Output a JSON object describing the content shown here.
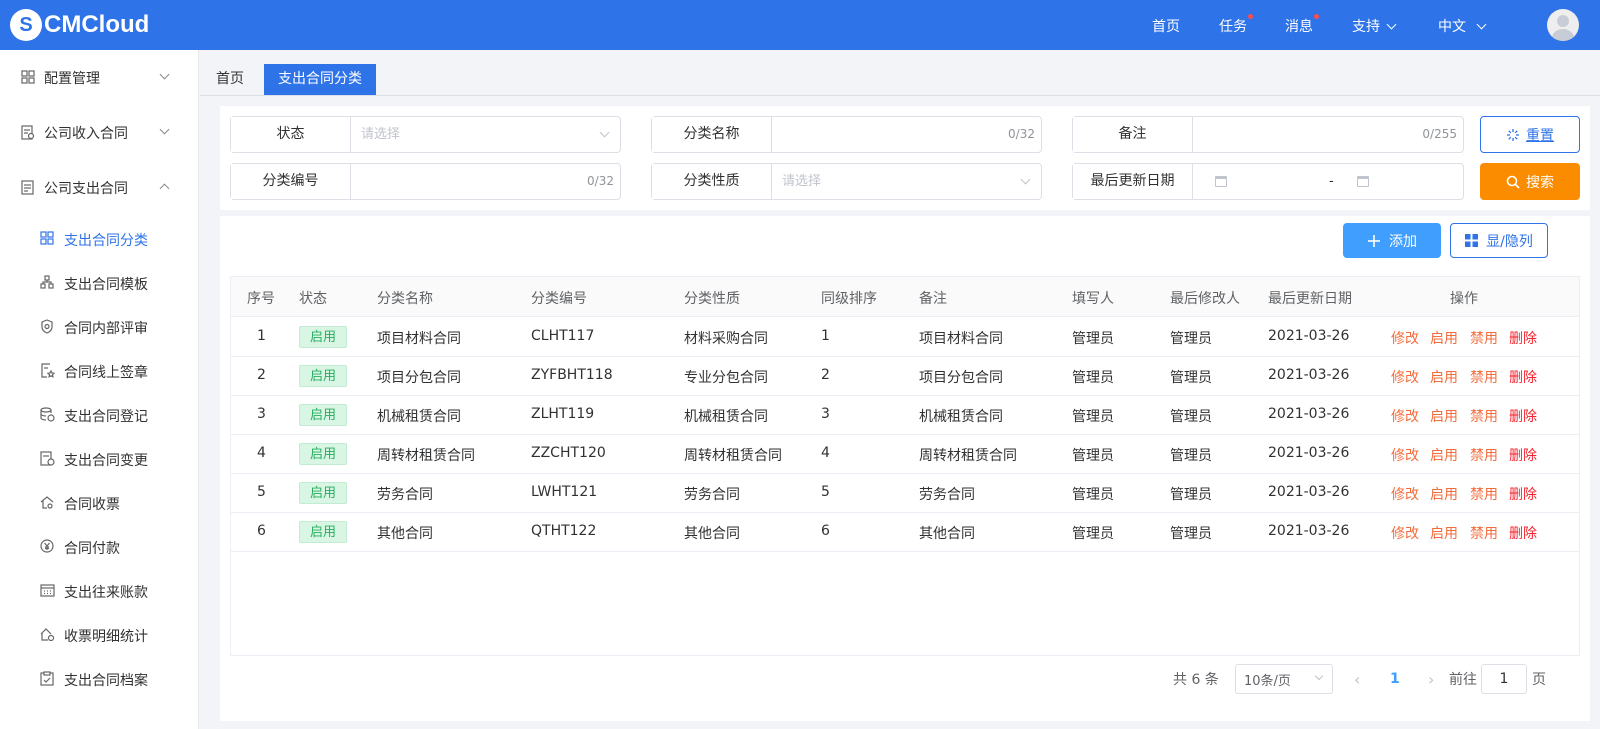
{
  "app": {
    "logo_text": "CMCloud",
    "logo_mark": "S"
  },
  "topnav": {
    "home": "首页",
    "tasks": "任务",
    "messages": "消息",
    "support": "支持",
    "language": "中文"
  },
  "sidebar": {
    "groups": [
      {
        "label": "配置管理",
        "icon": "grid-icon"
      },
      {
        "label": "公司收入合同",
        "icon": "contract-icon"
      },
      {
        "label": "公司支出合同",
        "icon": "document-icon"
      }
    ],
    "items": [
      {
        "label": "支出合同分类",
        "icon": "grid-icon"
      },
      {
        "label": "支出合同模板",
        "icon": "org-chart-icon"
      },
      {
        "label": "合同内部评审",
        "icon": "shield-icon"
      },
      {
        "label": "合同线上签章",
        "icon": "star-document-icon"
      },
      {
        "label": "支出合同登记",
        "icon": "database-icon"
      },
      {
        "label": "支出合同变更",
        "icon": "swap-document-icon"
      },
      {
        "label": "合同收票",
        "icon": "home-icon"
      },
      {
        "label": "合同付款",
        "icon": "yen-icon"
      },
      {
        "label": "支出往来账款",
        "icon": "calendar-icon"
      },
      {
        "label": "收票明细统计",
        "icon": "building-icon"
      },
      {
        "label": "支出合同档案",
        "icon": "clipboard-icon"
      }
    ]
  },
  "tabs": [
    {
      "label": "首页"
    },
    {
      "label": "支出合同分类"
    }
  ],
  "filters": {
    "status_label": "状态",
    "status_placeholder": "请选择",
    "name_label": "分类名称",
    "name_count": "0/32",
    "remark_label": "备注",
    "remark_count": "0/255",
    "code_label": "分类编号",
    "code_count": "0/32",
    "nature_label": "分类性质",
    "nature_placeholder": "请选择",
    "date_label": "最后更新日期",
    "date_sep": "-",
    "reset": "重置",
    "search": "搜索"
  },
  "toolbar": {
    "add": "添加",
    "columns": "显/隐列"
  },
  "table": {
    "headers": [
      "序号",
      "状态",
      "分类名称",
      "分类编号",
      "分类性质",
      "同级排序",
      "备注",
      "填写人",
      "最后修改人",
      "最后更新日期",
      "操作"
    ],
    "actions": [
      "修改",
      "启用",
      "禁用",
      "删除"
    ],
    "rows": [
      {
        "no": "1",
        "status": "启用",
        "name": "项目材料合同",
        "code": "CLHT117",
        "nature": "材料采购合同",
        "order": "1",
        "remark": "项目材料合同",
        "creator": "管理员",
        "modifier": "管理员",
        "date": "2021-03-26"
      },
      {
        "no": "2",
        "status": "启用",
        "name": "项目分包合同",
        "code": "ZYFBHT118",
        "nature": "专业分包合同",
        "order": "2",
        "remark": "项目分包合同",
        "creator": "管理员",
        "modifier": "管理员",
        "date": "2021-03-26"
      },
      {
        "no": "3",
        "status": "启用",
        "name": "机械租赁合同",
        "code": "ZLHT119",
        "nature": "机械租赁合同",
        "order": "3",
        "remark": "机械租赁合同",
        "creator": "管理员",
        "modifier": "管理员",
        "date": "2021-03-26"
      },
      {
        "no": "4",
        "status": "启用",
        "name": "周转材租赁合同",
        "code": "ZZCHT120",
        "nature": "周转材租赁合同",
        "order": "4",
        "remark": "周转材租赁合同",
        "creator": "管理员",
        "modifier": "管理员",
        "date": "2021-03-26"
      },
      {
        "no": "5",
        "status": "启用",
        "name": "劳务合同",
        "code": "LWHT121",
        "nature": "劳务合同",
        "order": "5",
        "remark": "劳务合同",
        "creator": "管理员",
        "modifier": "管理员",
        "date": "2021-03-26"
      },
      {
        "no": "6",
        "status": "启用",
        "name": "其他合同",
        "code": "QTHT122",
        "nature": "其他合同",
        "order": "6",
        "remark": "其他合同",
        "creator": "管理员",
        "modifier": "管理员",
        "date": "2021-03-26"
      }
    ]
  },
  "pagination": {
    "total": "共 6 条",
    "page_size": "10条/页",
    "current": "1",
    "goto_prefix": "前往",
    "goto_value": "1",
    "goto_suffix": "页"
  },
  "colors": {
    "primary": "#2f73e8",
    "orange": "#fb8c00",
    "success": "#27ae60",
    "danger": "#f5222d"
  }
}
